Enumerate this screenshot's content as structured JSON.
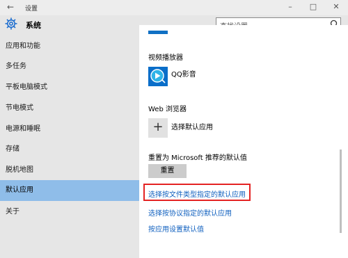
{
  "window": {
    "title": "设置"
  },
  "header": {
    "title": "系统",
    "search_placeholder": "查找设置"
  },
  "sidebar": {
    "items": [
      {
        "label": "应用和功能",
        "active": false
      },
      {
        "label": "多任务",
        "active": false
      },
      {
        "label": "平板电脑模式",
        "active": false
      },
      {
        "label": "节电模式",
        "active": false
      },
      {
        "label": "电源和睡眠",
        "active": false
      },
      {
        "label": "存储",
        "active": false
      },
      {
        "label": "脱机地图",
        "active": false
      },
      {
        "label": "默认应用",
        "active": true
      },
      {
        "label": "关于",
        "active": false
      }
    ]
  },
  "main": {
    "video_player": {
      "label": "视频播放器",
      "app_name": "QQ影音"
    },
    "web_browser": {
      "label": "Web 浏览器",
      "choose_label": "选择默认应用"
    },
    "reset": {
      "label": "重置为 Microsoft 推荐的默认值",
      "button": "重置"
    },
    "links": [
      "选择按文件类型指定的默认应用",
      "选择按协议指定的默认应用",
      "按应用设置默认值"
    ]
  },
  "colors": {
    "accent": "#1070c4",
    "selected_bg": "#8fbde9",
    "link": "#1060bf",
    "highlight_box": "#e42222"
  }
}
